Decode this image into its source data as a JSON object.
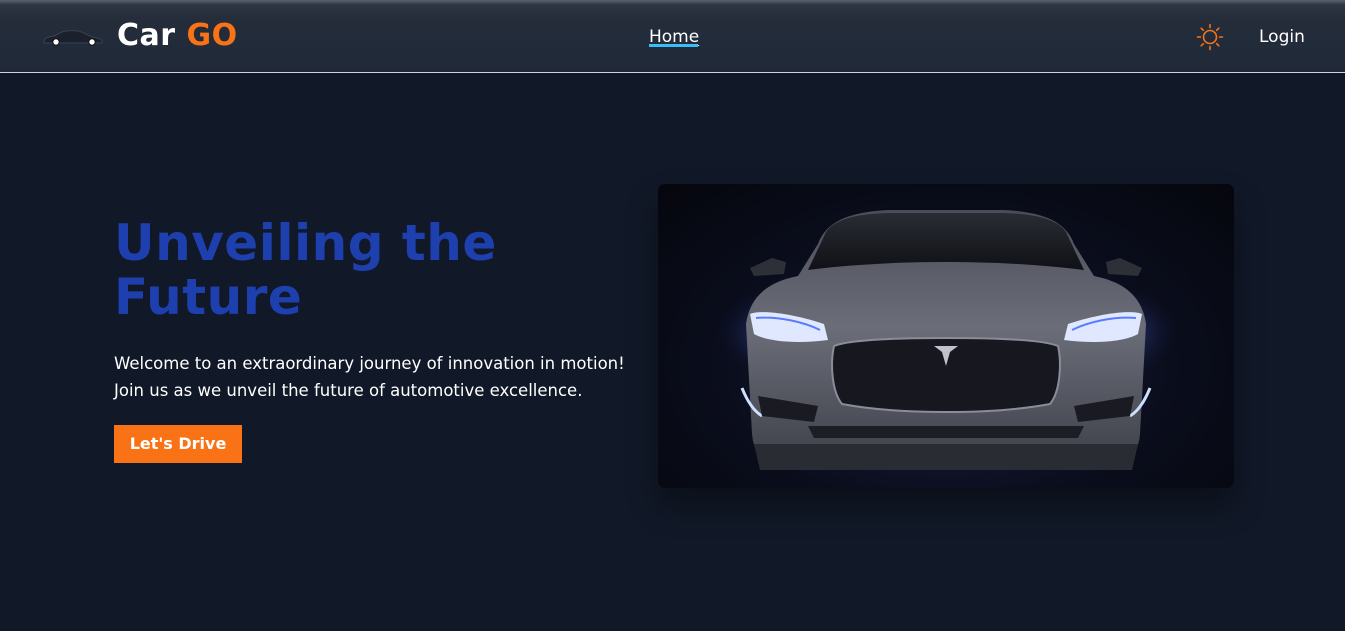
{
  "nav": {
    "brand_part1": "Car",
    "brand_part2": "GO",
    "home_label": "Home",
    "login_label": "Login",
    "logo_icon": "car-silhouette-icon",
    "theme_icon": "sun-icon"
  },
  "hero": {
    "title": "Unveiling the Future",
    "text_line1": "Welcome to an extraordinary journey of innovation in motion!",
    "text_line2": "Join us as we unveil the future of automotive excellence.",
    "cta_label": "Let's Drive"
  },
  "colors": {
    "accent": "#f97316",
    "title": "#1e40af",
    "nav_underline": "#38bdf8",
    "background": "#111827"
  }
}
